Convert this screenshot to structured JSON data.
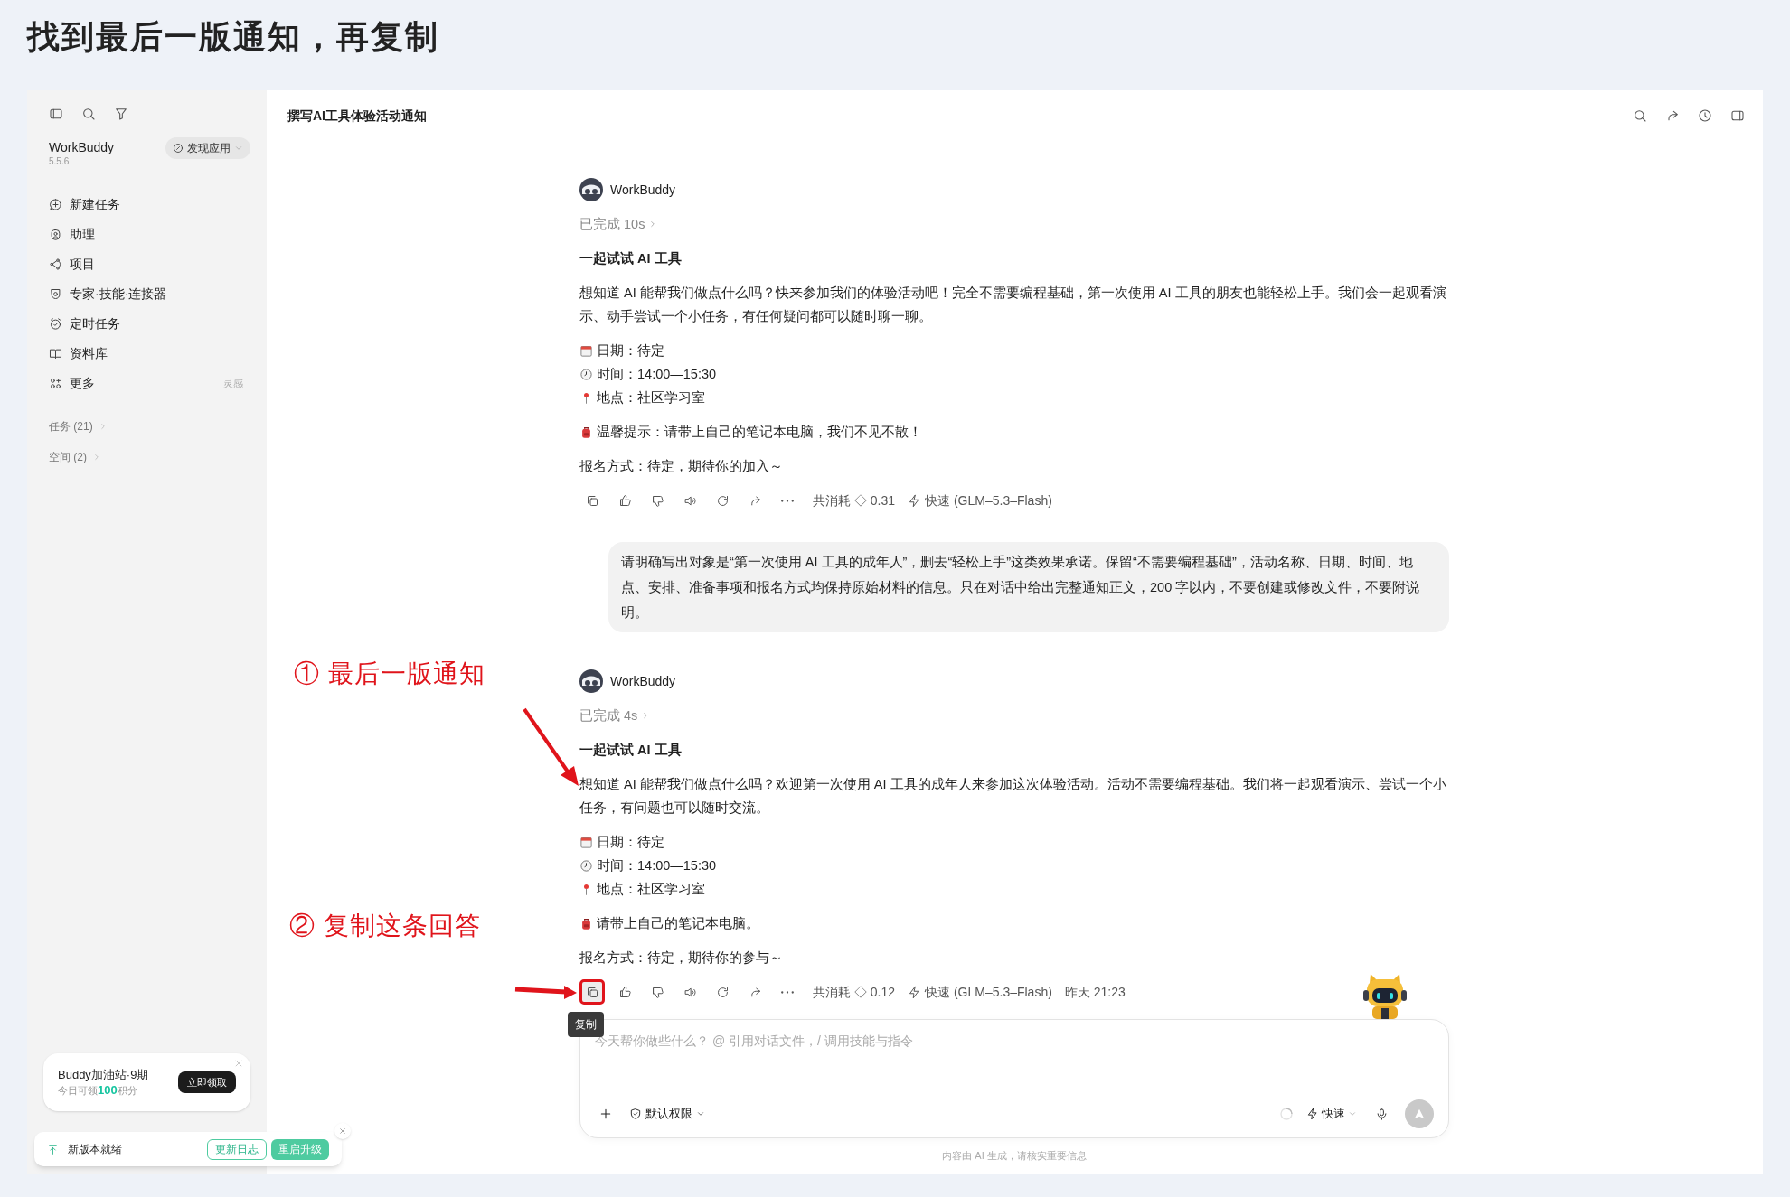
{
  "page_title": "找到最后一版通知，再复制",
  "sidebar": {
    "app_name": "WorkBuddy",
    "version": "5.5.6",
    "discover_button": "发现应用",
    "nav_items": [
      {
        "kind": "new",
        "label": "新建任务"
      },
      {
        "kind": "assistant",
        "label": "助理"
      },
      {
        "kind": "project",
        "label": "项目"
      },
      {
        "kind": "experts",
        "label": "专家·技能·连接器"
      },
      {
        "kind": "scheduled",
        "label": "定时任务"
      },
      {
        "kind": "library",
        "label": "资料库"
      },
      {
        "kind": "more",
        "label": "更多",
        "note": "灵感"
      }
    ],
    "sections": [
      {
        "label": "任务 (21)"
      },
      {
        "label": "空间 (2)"
      }
    ],
    "promo_card": {
      "title": "Buddy加油站·9期",
      "subtitle_before": "今日可领",
      "points": "100",
      "subtitle_after": "积分",
      "button": "立即领取"
    },
    "update_bar": {
      "label": "新版本就绪",
      "changelog_button": "更新日志",
      "upgrade_button": "重启升级"
    }
  },
  "header": {
    "title": "撰写AI工具体验活动通知"
  },
  "messages": [
    {
      "kind": "assistant",
      "name": "WorkBuddy",
      "status": "已完成 10s",
      "heading": "一起试试 AI 工具",
      "paragraph": "想知道 AI 能帮我们做点什么吗？快来参加我们的体验活动吧！完全不需要编程基础，第一次使用 AI 工具的朋友也能轻松上手。我们会一起观看演示、动手尝试一个小任务，有任何疑问都可以随时聊一聊。",
      "details": [
        {
          "kind": "date",
          "text": "日期：待定"
        },
        {
          "kind": "time",
          "text": "时间：14:00—15:30"
        },
        {
          "kind": "place",
          "text": "地点：社区学习室"
        }
      ],
      "tip": "温馨提示：请带上自己的笔记本电脑，我们不见不散！",
      "signup": "报名方式：待定，期待你的加入～",
      "cost": "共消耗 ◇ 0.31",
      "model": "快速 (GLM–5.3–Flash)",
      "copy_highlighted": false
    },
    {
      "kind": "user",
      "text": "请明确写出对象是“第一次使用 AI 工具的成年人”，删去“轻松上手”这类效果承诺。保留“不需要编程基础”，活动名称、日期、时间、地点、安排、准备事项和报名方式均保持原始材料的信息。只在对话中给出完整通知正文，200 字以内，不要创建或修改文件，不要附说明。"
    },
    {
      "kind": "assistant",
      "name": "WorkBuddy",
      "status": "已完成 4s",
      "heading": "一起试试 AI 工具",
      "paragraph": "想知道 AI 能帮我们做点什么吗？欢迎第一次使用 AI 工具的成年人来参加这次体验活动。活动不需要编程基础。我们将一起观看演示、尝试一个小任务，有问题也可以随时交流。",
      "details": [
        {
          "kind": "date",
          "text": "日期：待定"
        },
        {
          "kind": "time",
          "text": "时间：14:00—15:30"
        },
        {
          "kind": "place",
          "text": "地点：社区学习室"
        }
      ],
      "tip": "请带上自己的笔记本电脑。",
      "signup": "报名方式：待定，期待你的参与～",
      "cost": "共消耗 ◇ 0.12",
      "model": "快速 (GLM–5.3–Flash)",
      "time": "昨天 21:23",
      "copy_highlighted": true,
      "tooltip": "复制"
    }
  ],
  "composer": {
    "placeholder": "今天帮你做些什么？ @ 引用对话文件，/ 调用技能与指令",
    "permission": "默认权限",
    "mode": "快速"
  },
  "footer_note": "内容由 AI 生成，请核实重要信息",
  "annotations": [
    {
      "label": "① 最后一版通知"
    },
    {
      "label": "② 复制这条回答"
    }
  ]
}
